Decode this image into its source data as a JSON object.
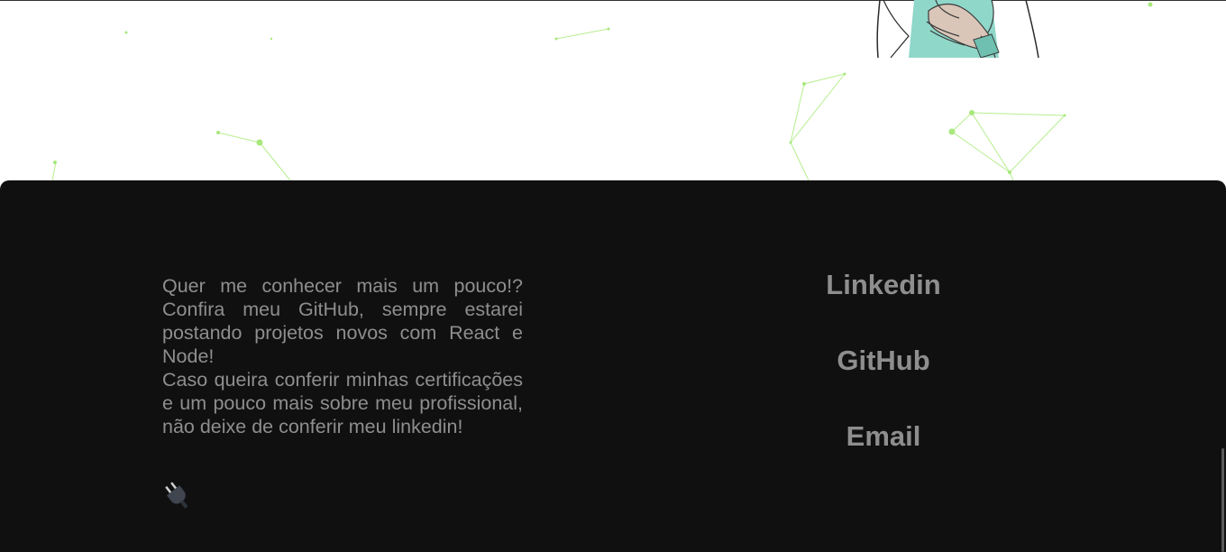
{
  "about": {
    "paragraph1": "Quer me conhecer mais um pouco!? Confira meu GitHub, sempre estarei postando projetos novos com React e Node!",
    "paragraph2": "Caso queira conferir minhas certificações e um pouco mais sobre meu profissional, não deixe de conferir meu linkedin!"
  },
  "links": {
    "linkedin": "Linkedin",
    "github": "GitHub",
    "email": "Email"
  },
  "icons": {
    "plug": "plug-icon"
  },
  "colors": {
    "footer_background": "#101010",
    "text": "#8e8e8e",
    "particles": "#9be36b",
    "illustration_accent": "#8fd7c9"
  }
}
